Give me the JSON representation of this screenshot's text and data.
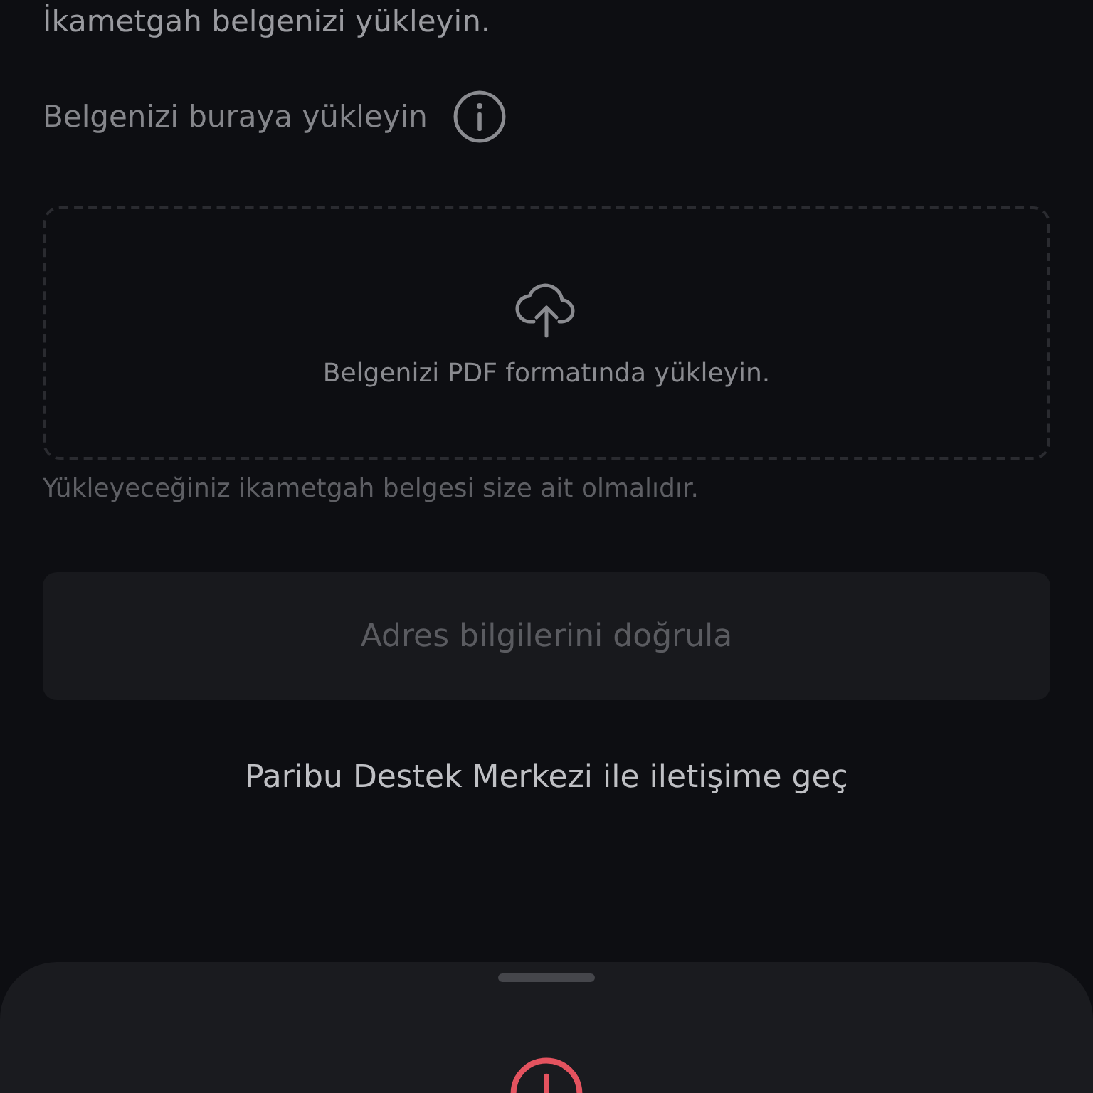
{
  "heading": "İkametgah belgenizi yükleyin.",
  "upload_label": "Belgenizi buraya yükleyin",
  "dropzone": {
    "text": "Belgenizi PDF formatında yükleyin."
  },
  "hint": "Yükleyeceğiniz ikametgah belgesi size ait olmalıdır.",
  "submit_button": {
    "label": "Adres bilgilerini doğrula",
    "disabled": true
  },
  "support_link": "Paribu Destek Merkezi ile iletişime geç"
}
